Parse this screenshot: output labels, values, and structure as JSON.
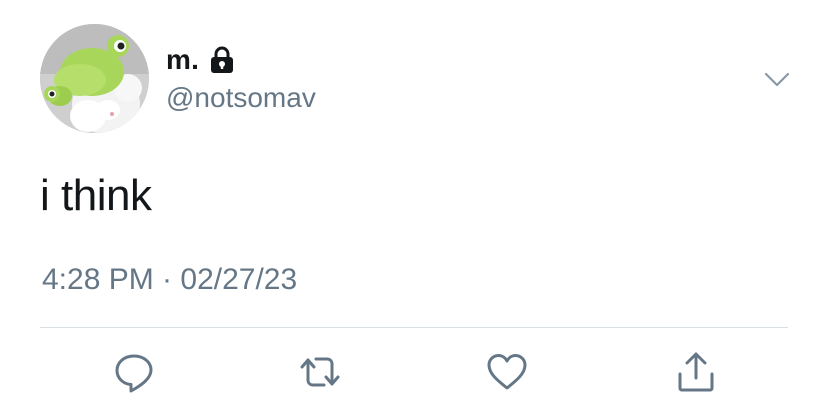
{
  "tweet": {
    "display_name": "m.",
    "handle": "@notsomav",
    "text": "i think",
    "timestamp": "4:28 PM · 02/27/23"
  },
  "icons": {
    "avatar": "frog-hat-plush-avatar",
    "verified_lock": "lock-icon",
    "menu": "chevron-down-icon",
    "reply": "reply-icon",
    "retweet": "retweet-icon",
    "like": "heart-icon",
    "share": "share-icon"
  },
  "colors": {
    "text_primary": "#14171a",
    "text_secondary": "#657786",
    "divider": "#d8dfe4",
    "icon": "#657786"
  }
}
